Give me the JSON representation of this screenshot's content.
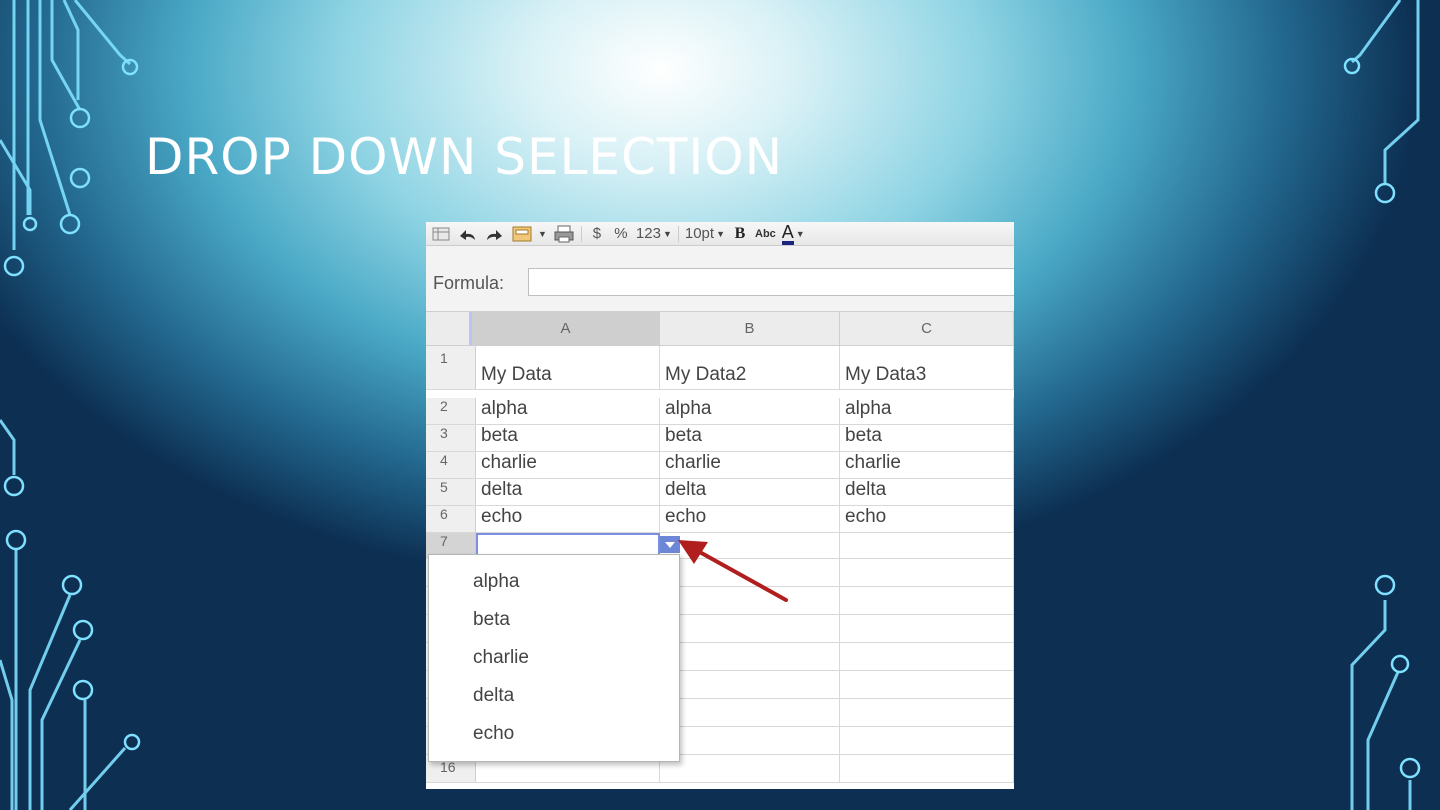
{
  "slide": {
    "title": "DROP DOWN SELECTION"
  },
  "toolbar": {
    "currency_label": "$",
    "percent_label": "%",
    "number_format_label": "123",
    "font_size_label": "10pt",
    "bold_label": "B",
    "strikethrough_label": "Abc",
    "text_color_label": "A",
    "text_color": "#1a237e"
  },
  "formula": {
    "label": "Formula:",
    "value": ""
  },
  "columns": [
    "A",
    "B",
    "C"
  ],
  "rows": [
    {
      "num": "1",
      "cells": [
        "My Data",
        "My Data2",
        "My Data3"
      ]
    },
    {
      "num": "2",
      "cells": [
        "alpha",
        "alpha",
        "alpha"
      ]
    },
    {
      "num": "3",
      "cells": [
        "beta",
        "beta",
        "beta"
      ]
    },
    {
      "num": "4",
      "cells": [
        "charlie",
        "charlie",
        "charlie"
      ]
    },
    {
      "num": "5",
      "cells": [
        "delta",
        "delta",
        "delta"
      ]
    },
    {
      "num": "6",
      "cells": [
        "echo",
        "echo",
        "echo"
      ]
    },
    {
      "num": "7",
      "cells": [
        "",
        "",
        ""
      ]
    },
    {
      "num": "16",
      "cells": [
        "",
        "",
        ""
      ]
    }
  ],
  "dropdown": {
    "options": [
      "alpha",
      "beta",
      "charlie",
      "delta",
      "echo"
    ]
  },
  "colors": {
    "selection_blue": "#6e86d6",
    "annotation_arrow": "#b01e1e"
  }
}
